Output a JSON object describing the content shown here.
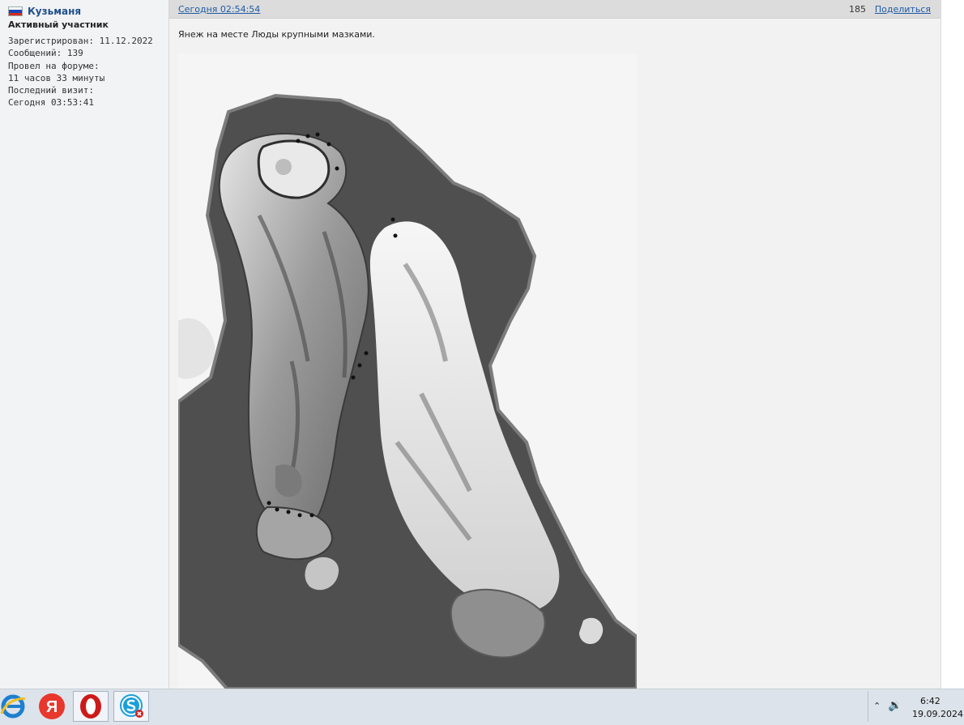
{
  "profile": {
    "username": "Кузьманя",
    "rank": "Активный участник",
    "registered": "Зарегистрирован: 11.12.2022",
    "messages": "Сообщений: 139",
    "time_label": "Провел на форуме:",
    "time_value": "11 часов 33 минуты",
    "last_visit_label": "Последний визит:",
    "last_visit_value": "Сегодня 03:53:41"
  },
  "post": {
    "timestamp": "Сегодня 02:54:54",
    "number": "185",
    "share": "Поделиться",
    "text": "Янеж на месте Люды крупными мазками."
  },
  "taskbar": {
    "apps": [
      "internet-explorer",
      "yandex-browser",
      "opera",
      "skype"
    ],
    "yandex_letter": "Я",
    "time": "6:42",
    "date": "19.09.2024"
  },
  "colors": {
    "username": "#1f4f8a",
    "link": "#1d5aa6",
    "opera_red": "#cc1a1a",
    "yandex_red": "#e8372c",
    "skype_blue": "#1a9fd9",
    "ie_blue": "#1e7fd0"
  }
}
